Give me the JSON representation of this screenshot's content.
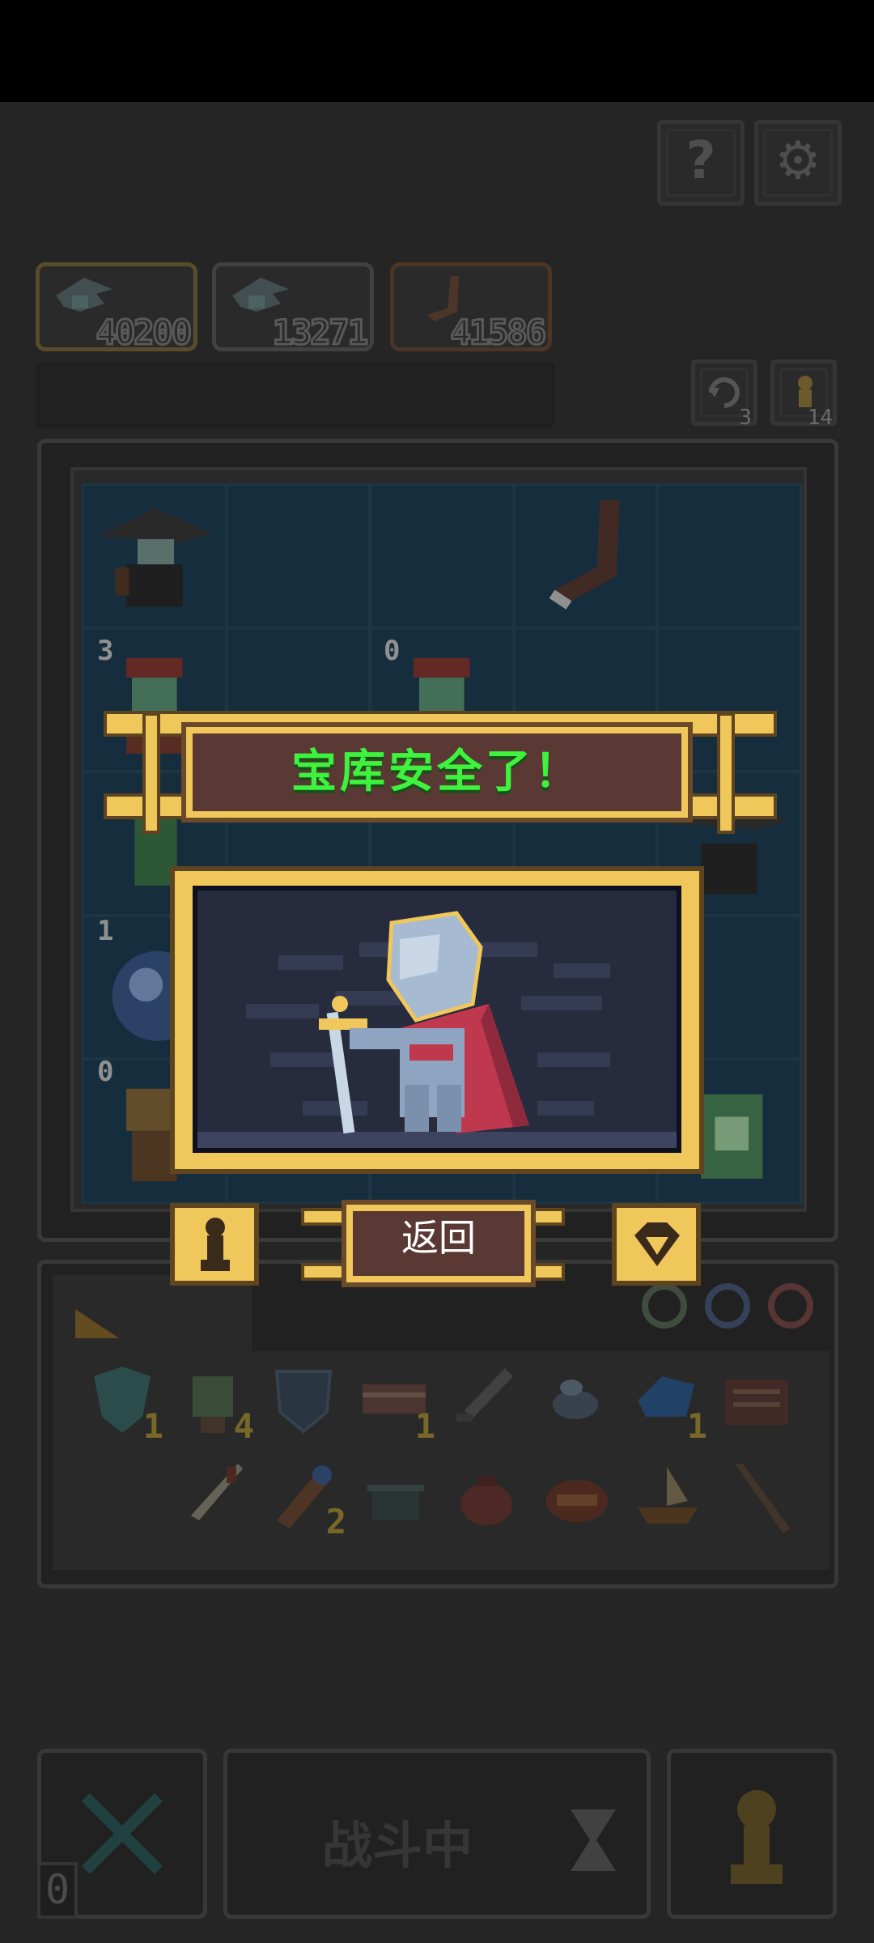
{
  "status_bar": {},
  "top_buttons": {
    "help_glyph": "?",
    "settings_glyph": "⚙"
  },
  "scores": [
    {
      "value": "40200",
      "style": "gold"
    },
    {
      "value": "13271",
      "style": "gray"
    },
    {
      "value": "41586",
      "style": "brown"
    }
  ],
  "side_counters": {
    "reroll_count": "3",
    "unit_count": "14"
  },
  "board": {
    "row1": [
      "bandit-hat",
      "empty",
      "empty",
      "empty",
      "boot-hook",
      "empty"
    ],
    "markers": {
      "r2c1": "3",
      "r2c3": "0",
      "r4c1": "1",
      "r5c1": "0"
    }
  },
  "dialog": {
    "title": "宝库安全了！",
    "return_label": "返回"
  },
  "inventory": {
    "row1_counts": [
      "1",
      "4",
      "",
      "1",
      "",
      "",
      "1",
      ""
    ],
    "row2_counts": [
      "",
      "2",
      "",
      "",
      "",
      "",
      ""
    ]
  },
  "bottom_bar": {
    "battle_label": "战斗中",
    "left_counter": "0"
  },
  "colors": {
    "accent_gold": "#f0c75a",
    "banner_bg": "#5a3934",
    "title_green": "#3ef23e",
    "board_cell": "#1e3f55"
  }
}
